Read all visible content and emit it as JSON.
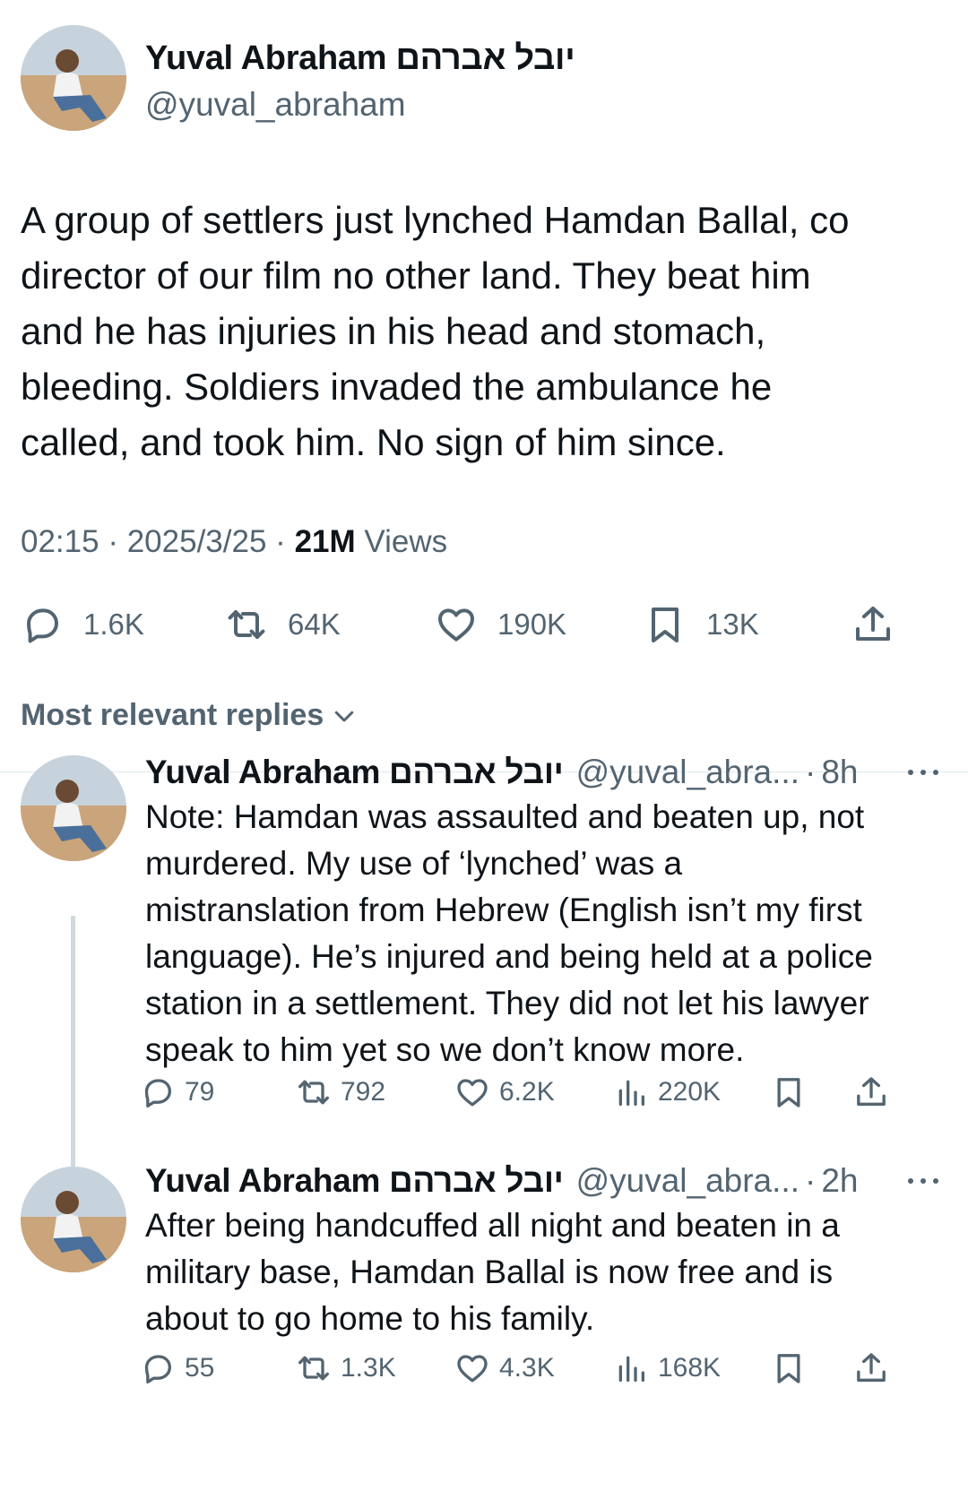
{
  "main_tweet": {
    "author_name": "Yuval Abraham יובל אברהם",
    "author_handle": "@yuval_abraham",
    "text_lines": [
      "A group of settlers just lynched Hamdan Ballal, co",
      "director of our film no other land. They beat him",
      "and he has injuries in his head and stomach,",
      "bleeding. Soldiers invaded the ambulance he",
      "called, and took him. No sign of him since."
    ],
    "time": "02:15",
    "separator": "·",
    "date": "2025/3/25",
    "views_count": "21M",
    "views_label": "Views",
    "stats": {
      "replies": "1.6K",
      "reposts": "64K",
      "likes": "190K",
      "bookmarks": "13K"
    }
  },
  "replies_header": "Most relevant replies",
  "replies": [
    {
      "author_name": "Yuval Abraham יובל אברהם",
      "author_handle": "@yuval_abra...",
      "dot": "·",
      "time": "8h",
      "text_lines": [
        "Note: Hamdan was assaulted and beaten up, not",
        "murdered. My use of ‘lynched’ was a",
        "mistranslation from Hebrew (English isn’t my first",
        "language). He’s injured and being held at a police",
        "station in a settlement. They did not let his lawyer",
        "speak to him yet so we don’t know more."
      ],
      "stats": {
        "replies": "79",
        "reposts": "792",
        "likes": "6.2K",
        "views": "220K"
      }
    },
    {
      "author_name": "Yuval Abraham יובל אברהם",
      "author_handle": "@yuval_abra...",
      "dot": "·",
      "time": "2h",
      "text_lines": [
        "After being handcuffed all night and beaten in a",
        "military base, Hamdan Ballal is now free and is",
        "about to go home to his family."
      ],
      "stats": {
        "replies": "55",
        "reposts": "1.3K",
        "likes": "4.3K",
        "views": "168K"
      }
    }
  ],
  "icons": {
    "reply": "speech-bubble-icon",
    "repost": "repost-arrows-icon",
    "like": "heart-icon",
    "bookmark": "bookmark-icon",
    "share": "share-upload-icon",
    "views": "bar-chart-icon",
    "more": "more-dots-icon",
    "chevron": "chevron-down-icon"
  },
  "colors": {
    "text_primary": "#0f1419",
    "text_secondary": "#536471",
    "divider": "#e1e8ed",
    "thread_line": "#cfd9de"
  }
}
